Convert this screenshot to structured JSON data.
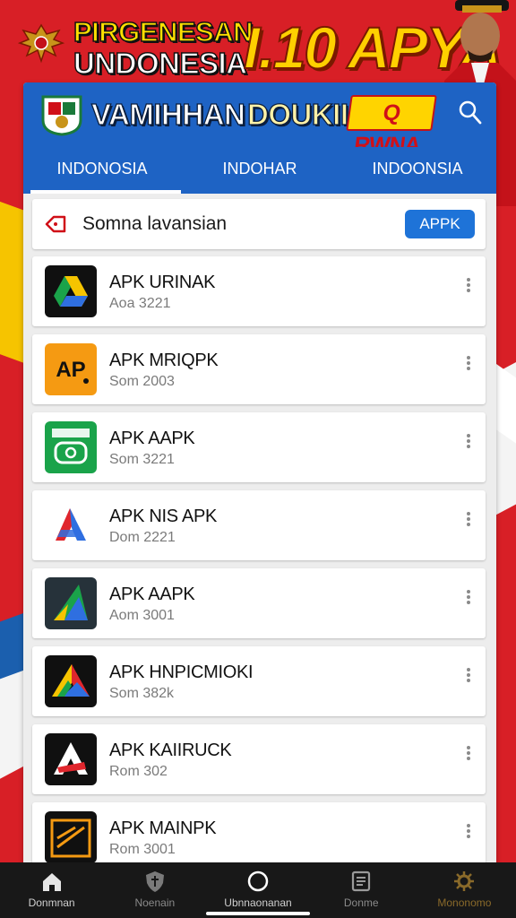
{
  "banner": {
    "line1": "PIRGENESAN",
    "line2": "UNDONESIA",
    "big": "I.10 APYA"
  },
  "app_bar": {
    "title_1": "VAMIHHAN",
    "title_2": "DOUKII",
    "badge": "Q RWNA"
  },
  "tabs": [
    {
      "label": "INDONOSIA",
      "active": true
    },
    {
      "label": "INDOHAR",
      "active": false
    },
    {
      "label": "INDOONSIA",
      "active": false
    }
  ],
  "filter": {
    "label": "Somna lavansian",
    "button_label": "APPK"
  },
  "items": [
    {
      "name": "APK URINAK",
      "sub": "Aoa 3221",
      "icon": "drive-icon"
    },
    {
      "name": "APK MRIQPK",
      "sub": "Som 2003",
      "icon": "ap-logo-icon"
    },
    {
      "name": "APK AAPK",
      "sub": "Som 3221",
      "icon": "green-app-icon"
    },
    {
      "name": "APK NIS APK",
      "sub": "Dom 2221",
      "icon": "a-logo-icon"
    },
    {
      "name": "APK AAPK",
      "sub": "Aom 3001",
      "icon": "triangle-app-icon"
    },
    {
      "name": "APK HNPICMIOKI",
      "sub": "Som 382k",
      "icon": "colorful-triangle-icon"
    },
    {
      "name": "APK KAIIRUCK",
      "sub": "Rom 302",
      "icon": "a-red-icon"
    },
    {
      "name": "APK MAINPK",
      "sub": "Rom 3001",
      "icon": "orange-box-icon"
    }
  ],
  "bottom_nav": [
    {
      "label": "Donmnan",
      "icon": "home-icon"
    },
    {
      "label": "Noenain",
      "icon": "shield-icon"
    },
    {
      "label": "Ubnnaonanan",
      "icon": "circle-icon"
    },
    {
      "label": "Donme",
      "icon": "document-icon"
    },
    {
      "label": "Mononomo",
      "icon": "gear-icon"
    }
  ],
  "colors": {
    "brand_blue": "#1e63c4",
    "background_red": "#d81f26",
    "button_blue": "#1e73d8"
  }
}
